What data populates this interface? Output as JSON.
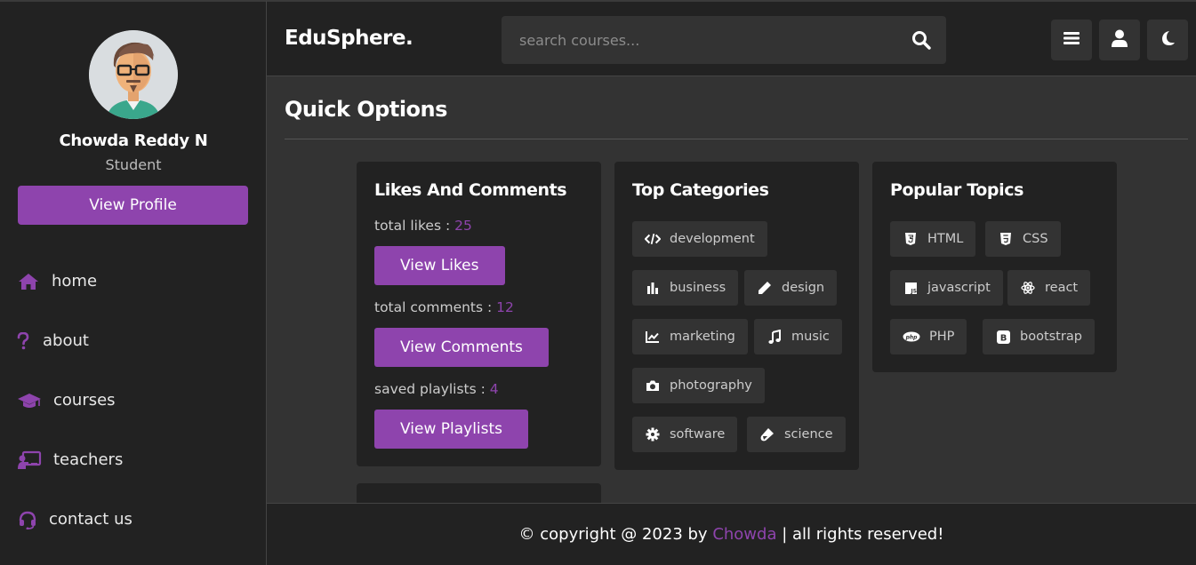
{
  "app": {
    "logo": "EduSphere.",
    "search_placeholder": "search courses..."
  },
  "profile": {
    "name": "Chowda Reddy N",
    "role": "Student",
    "view_profile_label": "View Profile"
  },
  "nav": [
    {
      "label": "home",
      "icon": "home-icon"
    },
    {
      "label": "about",
      "icon": "question-icon"
    },
    {
      "label": "courses",
      "icon": "graduation-cap-icon"
    },
    {
      "label": "teachers",
      "icon": "chalkboard-teacher-icon"
    },
    {
      "label": "contact us",
      "icon": "headset-icon"
    }
  ],
  "header_buttons": [
    "menu-icon",
    "user-icon",
    "moon-icon"
  ],
  "main": {
    "heading": "Quick Options",
    "likes_card": {
      "title": "Likes And Comments",
      "likes_label": "total likes : ",
      "likes_value": "25",
      "likes_button": "View Likes",
      "comments_label": "total comments : ",
      "comments_value": "12",
      "comments_button": "View Comments",
      "playlists_label": "saved playlists : ",
      "playlists_value": "4",
      "playlists_button": "View Playlists"
    },
    "categories_card": {
      "title": "Top Categories",
      "items": [
        {
          "label": "development",
          "icon": "code-icon"
        },
        {
          "label": "business",
          "icon": "chart-bar-icon"
        },
        {
          "label": "design",
          "icon": "pen-icon"
        },
        {
          "label": "marketing",
          "icon": "chart-line-icon"
        },
        {
          "label": "music",
          "icon": "music-icon"
        },
        {
          "label": "photography",
          "icon": "camera-icon"
        },
        {
          "label": "software",
          "icon": "cog-icon"
        },
        {
          "label": "science",
          "icon": "vial-icon"
        }
      ]
    },
    "topics_card": {
      "title": "Popular Topics",
      "items": [
        {
          "label": "HTML",
          "icon": "html5-icon"
        },
        {
          "label": "CSS",
          "icon": "css3-icon"
        },
        {
          "label": "javascript",
          "icon": "js-icon"
        },
        {
          "label": "react",
          "icon": "react-icon"
        },
        {
          "label": "PHP",
          "icon": "php-icon"
        },
        {
          "label": "bootstrap",
          "icon": "bootstrap-icon"
        }
      ]
    }
  },
  "footer": {
    "prefix": "© copyright @ 2023 by ",
    "brand": "Chowda",
    "suffix": " | all rights reserved!"
  },
  "colors": {
    "accent": "#8e44ad",
    "panel": "#222222",
    "background": "#333333"
  }
}
